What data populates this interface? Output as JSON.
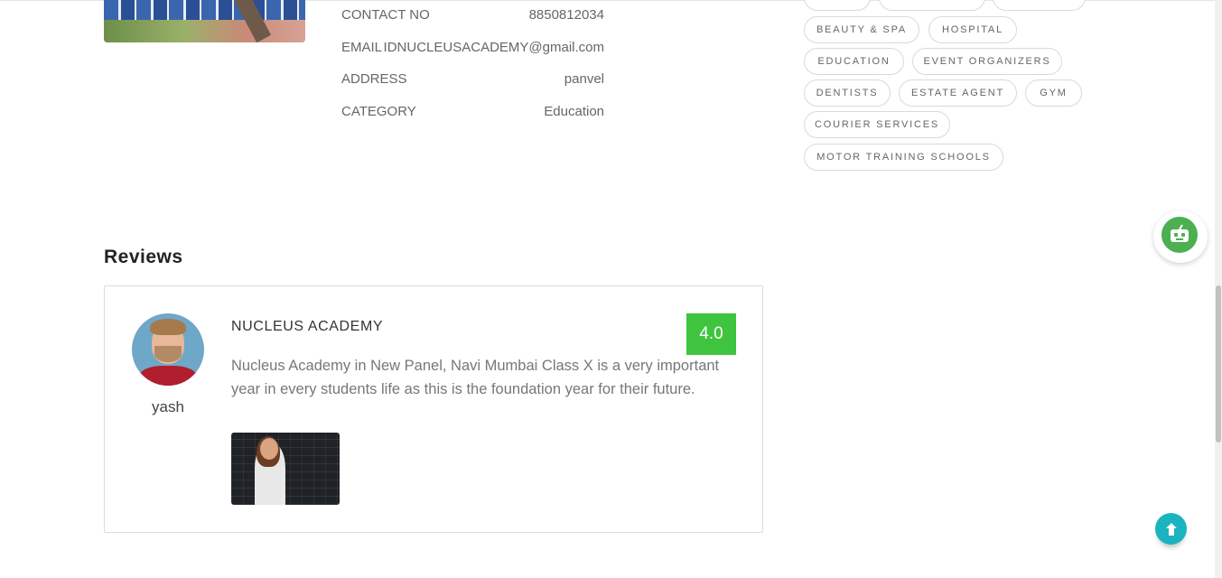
{
  "details": [
    {
      "label": "CONTACT NO",
      "value": "8850812034"
    },
    {
      "label": "EMAIL",
      "value": "IDNUCLEUSACADEMY@gmail.com"
    },
    {
      "label": "ADDRESS",
      "value": "panvel"
    },
    {
      "label": "CATEGORY",
      "value": "Education"
    }
  ],
  "categories": [
    "BEAUTY & SPA",
    "HOSPITAL",
    "EDUCATION",
    "EVENT ORGANIZERS",
    "DENTISTS",
    "ESTATE AGENT",
    "GYM",
    "COURIER SERVICES",
    "MOTOR TRAINING SCHOOLS"
  ],
  "reviews": {
    "title": "Reviews",
    "items": [
      {
        "reviewer": "yash",
        "heading": "NUCLEUS ACADEMY",
        "rating": "4.0",
        "text": "Nucleus Academy in New Panel, Navi Mumbai Class X is a very important year in every students life as this is the foundation year for their future."
      }
    ]
  },
  "colors": {
    "rating_badge": "#3ec43e",
    "scroll_top": "#19b4c0",
    "chat_bot": "#4caf50"
  },
  "icons": {
    "chat": "chatbot-icon",
    "scroll_top": "arrow-up-icon"
  }
}
